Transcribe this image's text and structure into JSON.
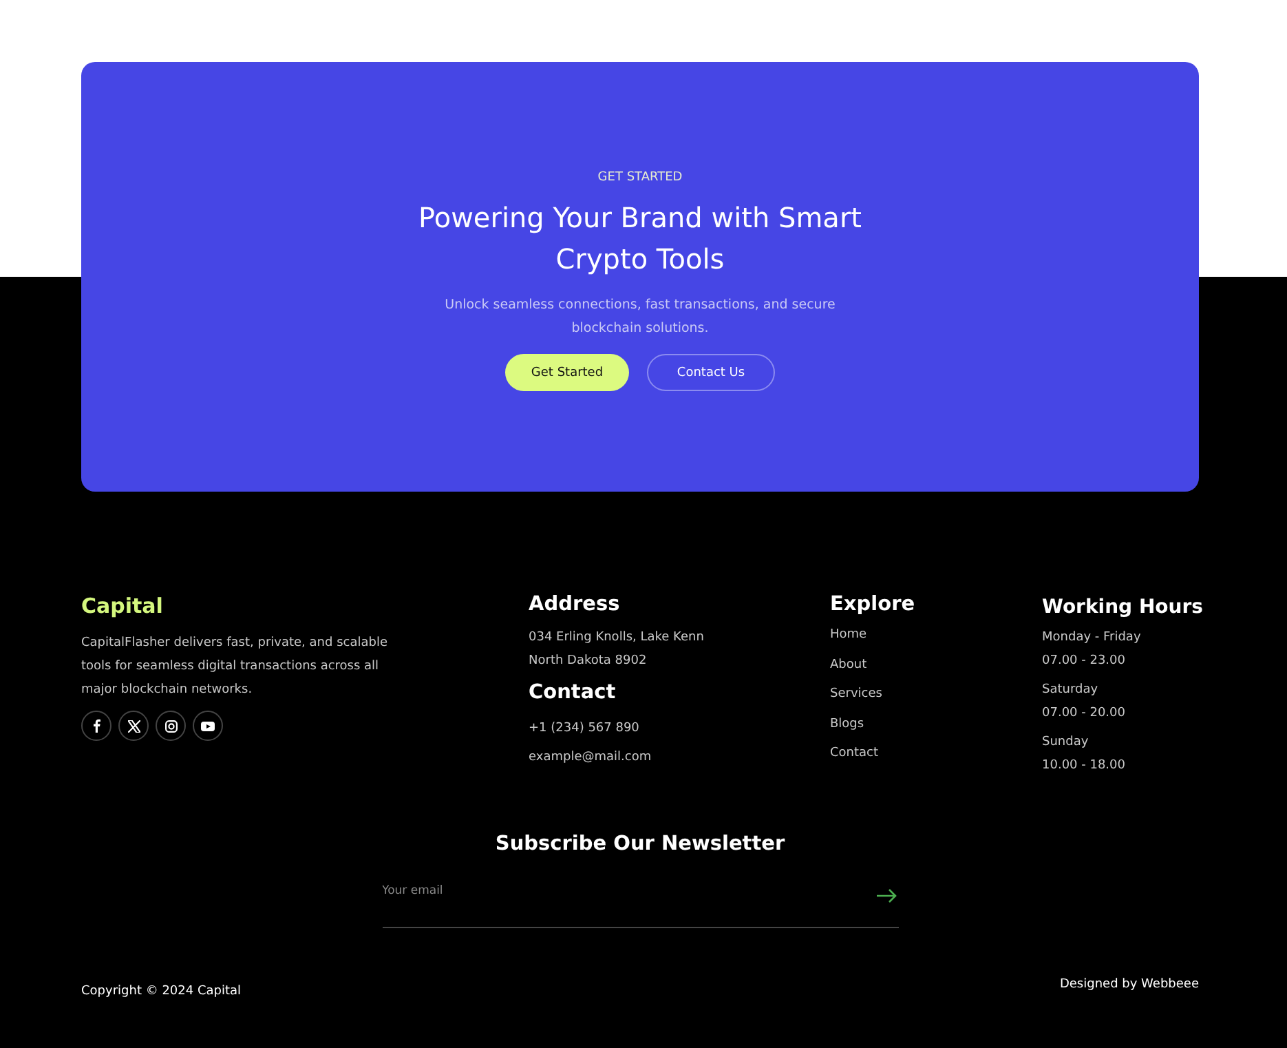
{
  "cta": {
    "eyebrow": "GET STARTED",
    "title": "Powering Your Brand with Smart Crypto Tools",
    "text": "Unlock seamless connections, fast transactions, and secure blockchain solutions.",
    "buttons": [
      {
        "label": "Get Started",
        "kind": "primary"
      },
      {
        "label": "Contact Us",
        "kind": "outline"
      }
    ]
  },
  "brand": {
    "name": "Capital",
    "description": "CapitalFlasher delivers fast, private, and scalable tools for seamless digital transactions across all major blockchain networks.",
    "socials": [
      {
        "kind": "facebook"
      },
      {
        "kind": "x"
      },
      {
        "kind": "instagram"
      },
      {
        "kind": "youtube"
      }
    ]
  },
  "address": {
    "title": "Address",
    "lines": [
      "034 Erling Knolls, Lake Kenn",
      "North Dakota 8902"
    ]
  },
  "contact": {
    "title": "Contact",
    "lines": [
      "+1 (234) 567 890",
      "example@mail.com"
    ]
  },
  "explore": {
    "title": "Explore",
    "links": [
      "Home",
      "About",
      "Services",
      "Blogs",
      "Contact"
    ]
  },
  "hours": {
    "title": "Working Hours",
    "entries": [
      {
        "day": "Monday - Friday",
        "time": "07.00 - 23.00"
      },
      {
        "day": "Saturday",
        "time": "07.00 - 20.00"
      },
      {
        "day": "Sunday",
        "time": "10.00 - 18.00"
      }
    ]
  },
  "newsletter": {
    "title": "Subscribe Our Newsletter",
    "placeholder": "Your email"
  },
  "bottom": {
    "copyright": "Copyright © 2024 Capital",
    "credit": "Designed by Webbeee"
  }
}
